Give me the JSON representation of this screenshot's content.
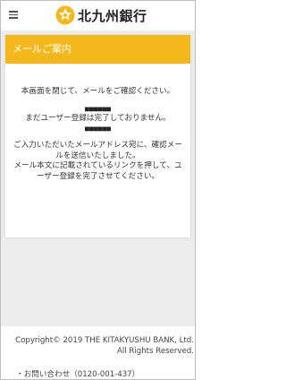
{
  "header": {
    "logo_text": "北九州銀行"
  },
  "card": {
    "title": "メールご案内",
    "message_close": "本画面を閉じて、メールをご確認ください。",
    "masked_email_1": "■■■■■■",
    "message_incomplete": "まだユーザー登録は完了しておりません。",
    "masked_email_2": "■■■■■■",
    "message_sent": "ご入力いただいたメールアドレス宛に、確認メールを送信いたしました。",
    "message_instruction": "メール本文に記載されているリンクを押して、ユーザー登録を完了させてください。"
  },
  "footer": {
    "copyright": "Copyright© 2019 THE KITAKYUSHU BANK, Ltd. All Rights Reserved.",
    "contact": "・お問い合わせ（0120-001-437）"
  }
}
